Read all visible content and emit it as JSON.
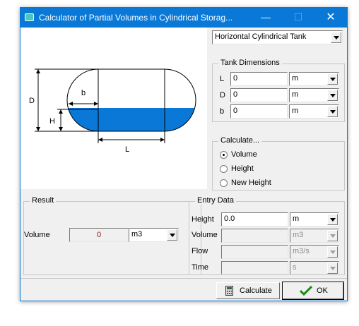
{
  "window": {
    "title": "Calculator of Partial Volumes in Cylindrical Storag...",
    "minimize_glyph": "—",
    "maximize_glyph": "☐",
    "close_glyph": "✕",
    "icon": "calculator-app-icon"
  },
  "tank_type": {
    "selected": "Horizontal Cylindrical Tank"
  },
  "diagram": {
    "labels": {
      "d": "D",
      "h": "H",
      "b": "b",
      "l": "L"
    },
    "liquid_color": "#0a78d7"
  },
  "tank_dimensions": {
    "title": "Tank Dimensions",
    "rows": [
      {
        "label": "L",
        "value": "0",
        "unit": "m"
      },
      {
        "label": "D",
        "value": "0",
        "unit": "m"
      },
      {
        "label": "b",
        "value": "0",
        "unit": "m"
      }
    ]
  },
  "calculate": {
    "title": "Calculate...",
    "options": [
      {
        "label": "Volume",
        "selected": true
      },
      {
        "label": "Height",
        "selected": false
      },
      {
        "label": "New Height",
        "selected": false
      }
    ]
  },
  "result": {
    "title": "Result",
    "label": "Volume",
    "value": "0",
    "unit": "m3",
    "value_color": "#8b1a1a"
  },
  "entry_data": {
    "title": "Entry Data",
    "rows": [
      {
        "label": "Height",
        "value": "0.0",
        "unit": "m",
        "enabled": true
      },
      {
        "label": "Volume",
        "value": "",
        "unit": "m3",
        "enabled": false
      },
      {
        "label": "Flow",
        "value": "",
        "unit": "m3/s",
        "enabled": false
      },
      {
        "label": "Time",
        "value": "",
        "unit": "s",
        "enabled": false
      }
    ]
  },
  "buttons": {
    "calculate": {
      "label": "Calculate",
      "icon": "calculator-icon"
    },
    "ok": {
      "label": "OK",
      "icon": "checkmark-icon",
      "icon_color": "#1a8a1a"
    }
  }
}
